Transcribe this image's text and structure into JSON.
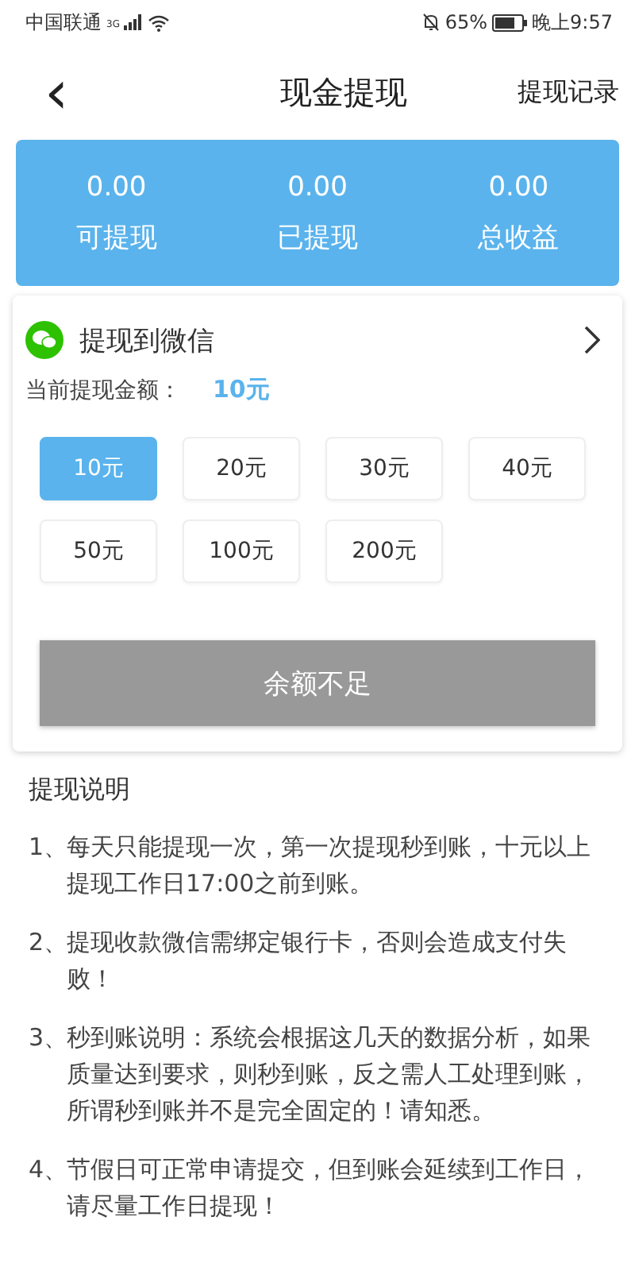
{
  "status_bar": {
    "carrier": "中国联通",
    "network": "3G",
    "battery": "65%",
    "time": "晚上9:57"
  },
  "header": {
    "back": "‹",
    "title": "现金提现",
    "action": "提现记录"
  },
  "stats": [
    {
      "value": "0.00",
      "label": "可提现"
    },
    {
      "value": "0.00",
      "label": "已提现"
    },
    {
      "value": "0.00",
      "label": "总收益"
    }
  ],
  "withdraw": {
    "method": "提现到微信",
    "amount_label": "当前提现金额：",
    "amount": "10元",
    "options": [
      {
        "label": "10元",
        "selected": true
      },
      {
        "label": "20元",
        "selected": false
      },
      {
        "label": "30元",
        "selected": false
      },
      {
        "label": "40元",
        "selected": false
      },
      {
        "label": "50元",
        "selected": false
      },
      {
        "label": "100元",
        "selected": false
      },
      {
        "label": "200元",
        "selected": false
      }
    ],
    "submit": {
      "label": "余额不足",
      "disabled": true
    }
  },
  "notes": {
    "title": "提现说明",
    "items": [
      {
        "number": "1、",
        "text": "每天只能提现一次，第一次提现秒到账，十元以上提现工作日17:00之前到账。"
      },
      {
        "number": "2、",
        "text": "提现收款微信需绑定银行卡，否则会造成支付失败！"
      },
      {
        "number": "3、",
        "text": "秒到账说明：系统会根据这几天的数据分析，如果质量达到要求，则秒到账，反之需人工处理到账，所谓秒到账并不是完全固定的！请知悉。"
      },
      {
        "number": "4、",
        "text": "节假日可正常申请提交，但到账会延续到工作日，请尽量工作日提现！"
      }
    ]
  }
}
